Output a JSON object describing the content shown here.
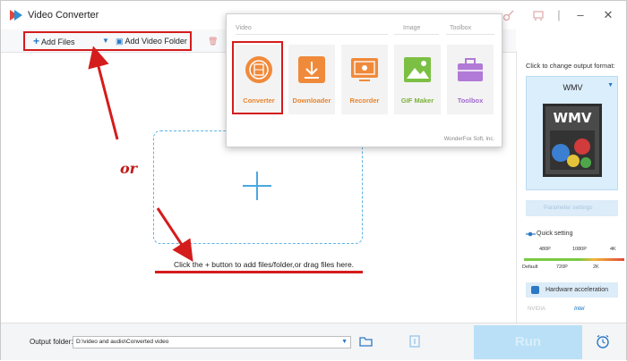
{
  "app": {
    "title": "Video Converter"
  },
  "toolbar": {
    "add_files": "Add Files",
    "add_folder": "Add Video Folder"
  },
  "popup": {
    "sections": [
      "Video",
      "Image",
      "Toolbox"
    ],
    "tiles": [
      {
        "label": "Converter",
        "icon": "film-icon"
      },
      {
        "label": "Downloader",
        "icon": "download-arrow-icon"
      },
      {
        "label": "Recorder",
        "icon": "screen-record-icon"
      },
      {
        "label": "GIF Maker",
        "icon": "image-landscape-icon"
      },
      {
        "label": "Toolbox",
        "icon": "toolbox-icon"
      }
    ],
    "copyright": "WonderFox Soft, Inc."
  },
  "annotation": {
    "or": "or"
  },
  "main": {
    "hint": "Click the + button to add files/folder,or drag files here."
  },
  "right_panel": {
    "change_format_label": "Click to change output format:",
    "format": "WMV",
    "format_image_text": "WMV",
    "parameter_settings": "Parameter settings",
    "quick_setting": "Quick setting",
    "ticks_top": [
      "480P",
      "1080P",
      "4K"
    ],
    "ticks_bottom": [
      "Default",
      "720P",
      "2K"
    ],
    "hw_accel": "Hardware acceleration",
    "gpu": [
      "NVIDIA",
      "Intel"
    ]
  },
  "bottom": {
    "output_label": "Output folder:",
    "output_path": "D:\\video and audio\\Converted video",
    "run": "Run"
  },
  "colors": {
    "accent_red": "#d51c1c",
    "orange": "#e8842d",
    "blue": "#4aa8e0"
  }
}
